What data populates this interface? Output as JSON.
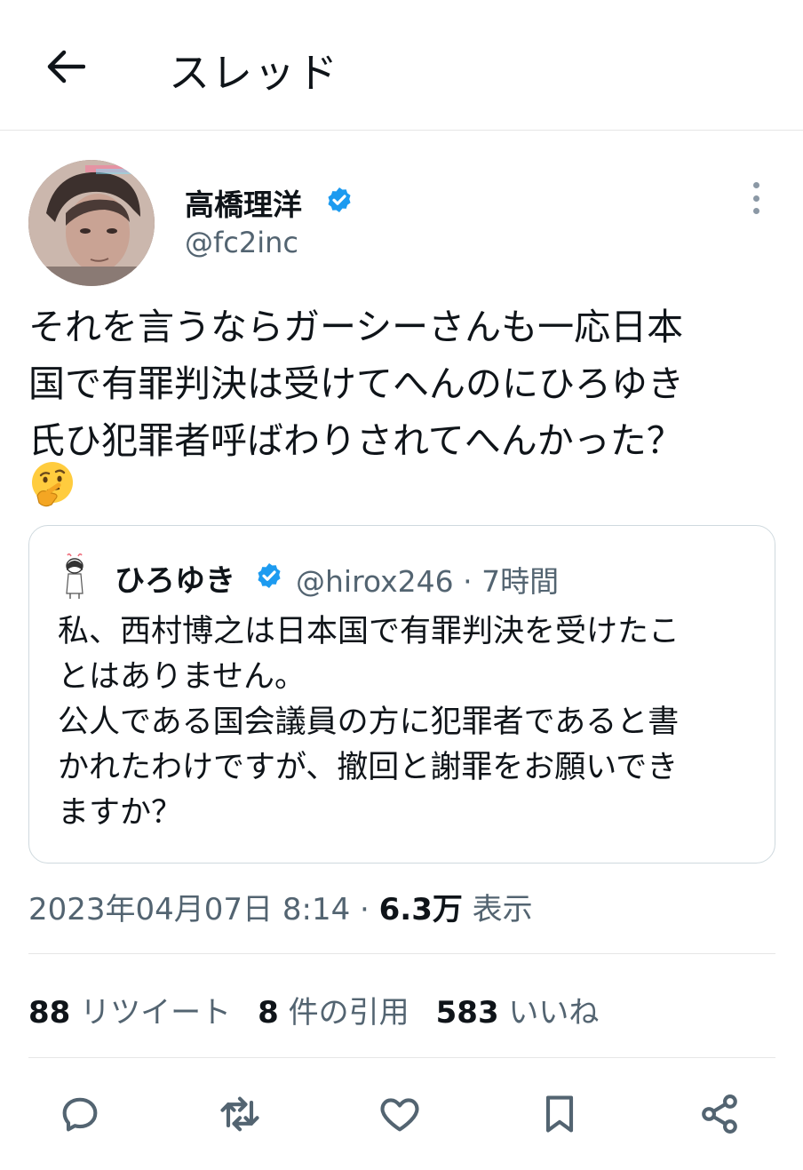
{
  "header": {
    "title": "スレッド",
    "back_icon": "arrow-left-icon"
  },
  "tweet": {
    "author_name": "高橋理洋",
    "author_handle": "@fc2inc",
    "text": "それを言うならガーシーさんも一応日本\n国で有罪判決は受けてへんのにひろゆき\n氏ひ犯罪者呼ばわりされてへんかった？",
    "emoji": "thinking-face-icon",
    "timestamp": "2023年04月07日 8:14 · ",
    "views_count": "6.3万",
    "views_label": " 表示"
  },
  "quote": {
    "author_name": "ひろゆき",
    "meta": "@hirox246 · 7時間",
    "text": "私、西村博之は日本国で有罪判決を受けたこ\nとはありません。\n公人である国会議員の方に犯罪者であると書\nかれたわけですが、撤回と謝罪をお願いでき\nますか？"
  },
  "stats": {
    "retweets_count": "88",
    "retweets_label": " リツイート",
    "quotes_count": "8",
    "quotes_label": " 件の引用",
    "likes_count": "583",
    "likes_label": " いいね"
  },
  "colors": {
    "text": "#0f1419",
    "muted": "#536471",
    "verified": "#1d9bf0",
    "border": "#cfd9de"
  }
}
